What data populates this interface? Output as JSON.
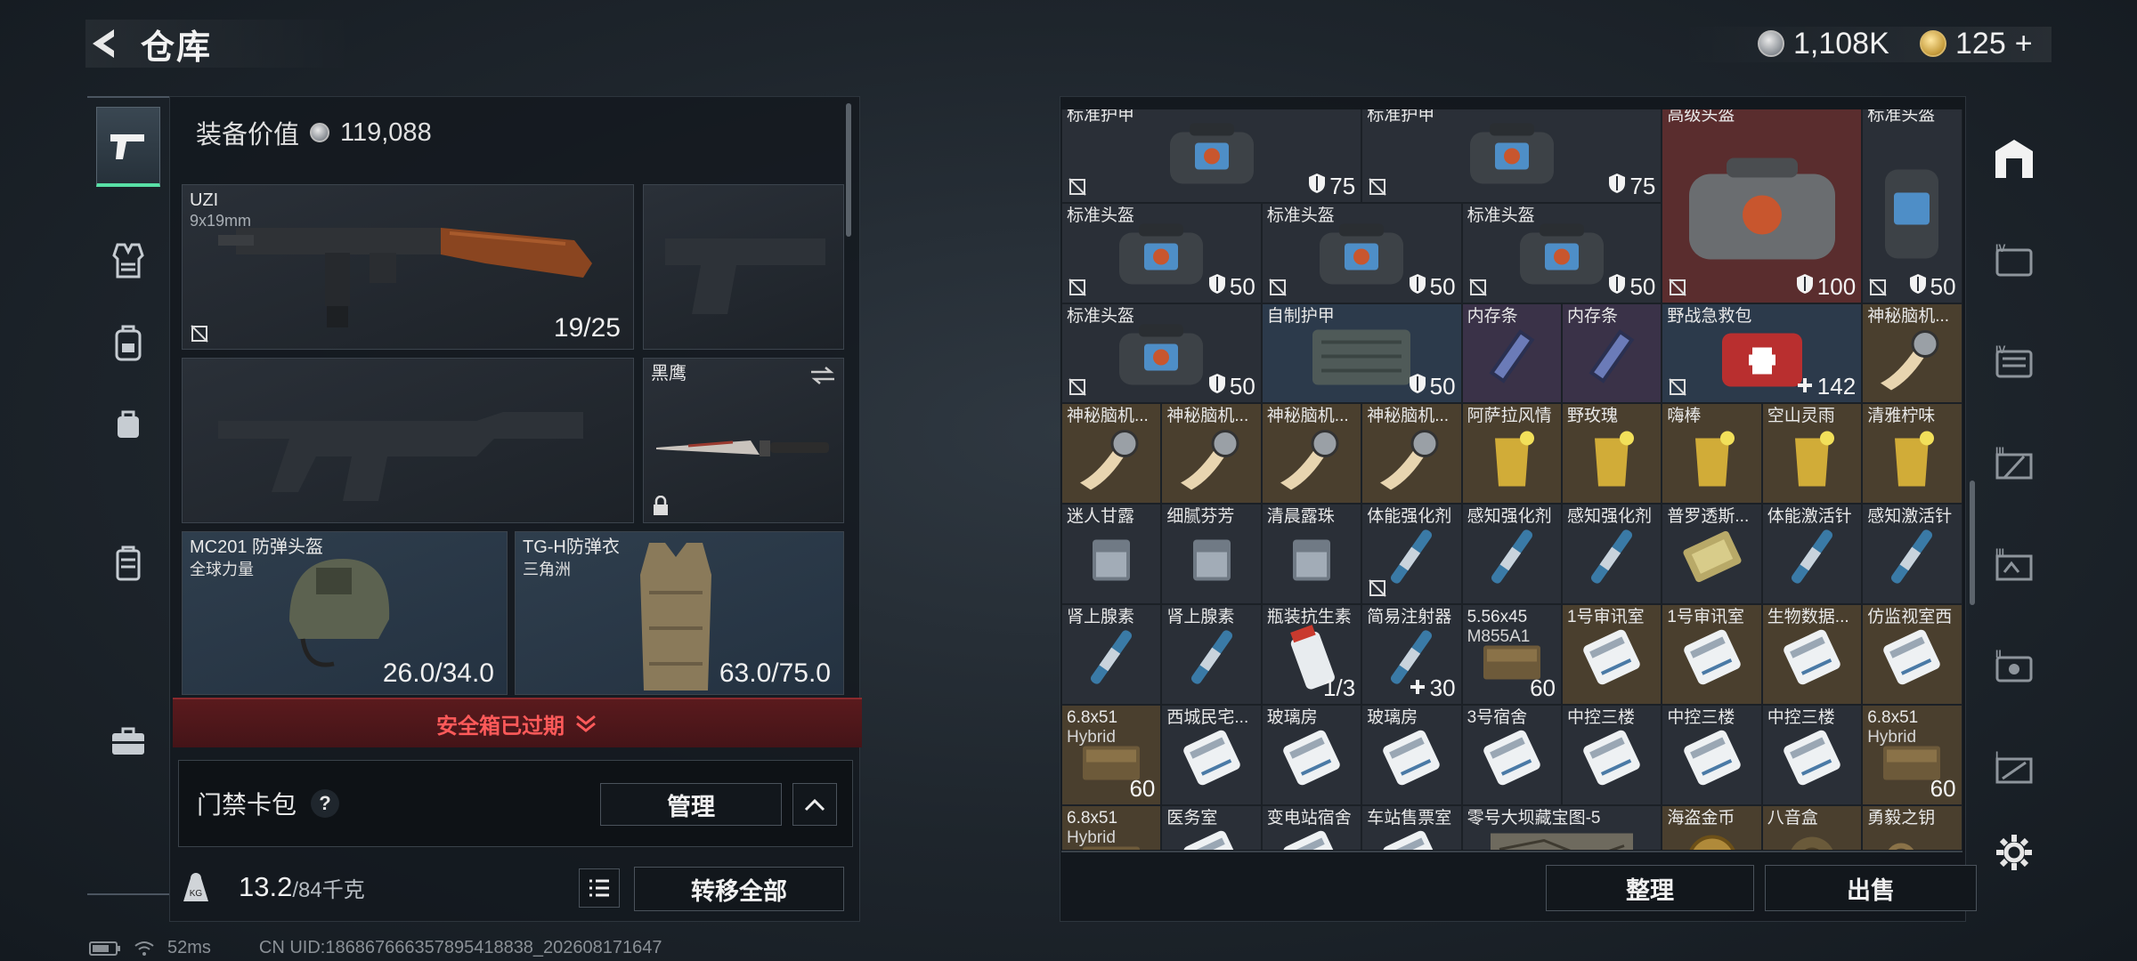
{
  "header": {
    "title": "仓库",
    "back_icon": "back-arrow-icon"
  },
  "currency": {
    "silver": "1,108K",
    "gold": "125",
    "gold_add": "+"
  },
  "left_nav": [
    {
      "name": "weapon",
      "icon": "pistol-icon",
      "active": true
    },
    {
      "name": "armor",
      "icon": "vest-icon"
    },
    {
      "name": "backpack",
      "icon": "backpack-icon"
    },
    {
      "name": "bag",
      "icon": "small-bag-icon"
    },
    {
      "name": "case",
      "icon": "case-icon"
    },
    {
      "name": "toolbox",
      "icon": "toolbox-icon"
    }
  ],
  "equipment": {
    "value_label": "装备价值",
    "value": "119,088",
    "primary": {
      "name": "UZI",
      "ammo": "9x19mm",
      "count": "19/25"
    },
    "melee": {
      "name": "黑鹰"
    },
    "helmet": {
      "name": "MC201 防弹头盔",
      "sub": "全球力量",
      "durability": "26.0/34.0"
    },
    "armor": {
      "name": "TG-H防弹衣",
      "sub": "三角洲",
      "durability": "63.0/75.0"
    }
  },
  "safebox": {
    "expired_text": "安全箱已过期"
  },
  "keycard": {
    "label": "门禁卡包",
    "help": "?",
    "manage": "管理"
  },
  "weight": {
    "current": "13.2",
    "max": "/84千克",
    "unit_icon": "KG"
  },
  "transfer_all": "转移全部",
  "stash": {
    "rows": [
      [
        {
          "n": "标准护甲",
          "v": "75",
          "t": "shield"
        },
        {
          "n": "标准护甲",
          "v": "75",
          "t": "shield"
        },
        {
          "n": "高级头盔",
          "v": "100",
          "t": "shield"
        },
        {
          "n": "标准头盔",
          "v": "50",
          "t": "shield"
        }
      ],
      [
        {
          "n": "标准头盔",
          "v": "50"
        },
        {
          "n": "标准头盔",
          "v": "50"
        },
        {
          "n": "标准头盔",
          "v": "50"
        }
      ],
      [
        {
          "n": "标准头盔",
          "v": "50"
        },
        {
          "n": "自制护甲",
          "v": "50"
        },
        {
          "n": "内存条"
        },
        {
          "n": "内存条"
        },
        {
          "n": "野战急救包",
          "v": "142"
        },
        {
          "n": "神秘脑机..."
        }
      ],
      [
        {
          "n": "神秘脑机..."
        },
        {
          "n": "神秘脑机..."
        },
        {
          "n": "神秘脑机..."
        },
        {
          "n": "神秘脑机..."
        },
        {
          "n": "阿萨拉风情"
        },
        {
          "n": "野玫瑰"
        },
        {
          "n": "嗨棒"
        },
        {
          "n": "空山灵雨"
        },
        {
          "n": "清雅柠味"
        }
      ],
      [
        {
          "n": "迷人甘露"
        },
        {
          "n": "细腻芬芳"
        },
        {
          "n": "清晨露珠"
        },
        {
          "n": "体能强化剂"
        },
        {
          "n": "感知强化剂"
        },
        {
          "n": "感知强化剂"
        },
        {
          "n": "普罗透斯..."
        },
        {
          "n": "体能激活针"
        },
        {
          "n": "感知激活针"
        }
      ],
      [
        {
          "n": "肾上腺素"
        },
        {
          "n": "肾上腺素"
        },
        {
          "n": "瓶装抗生素",
          "v": "1/3"
        },
        {
          "n": "简易注射器",
          "v": "30"
        },
        {
          "n": "5.56x45",
          "n2": "M855A1",
          "v": "60"
        },
        {
          "n": "1号审讯室"
        },
        {
          "n": "1号审讯室"
        },
        {
          "n": "生物数据..."
        },
        {
          "n": "仿监视室西"
        }
      ],
      [
        {
          "n": "6.8x51",
          "n2": "Hybrid",
          "v": "60"
        },
        {
          "n": "西城民宅..."
        },
        {
          "n": "玻璃房"
        },
        {
          "n": "玻璃房"
        },
        {
          "n": "3号宿舍"
        },
        {
          "n": "中控三楼"
        },
        {
          "n": "中控三楼"
        },
        {
          "n": "中控三楼"
        },
        {
          "n": "6.8x51",
          "n2": "Hybrid",
          "v": "60"
        }
      ],
      [
        {
          "n": "6.8x51",
          "n2": "Hybrid"
        },
        {
          "n": "医务室"
        },
        {
          "n": "变电站宿舍"
        },
        {
          "n": "车站售票室"
        },
        {
          "n": "零号大坝藏宝图-5"
        },
        {
          "n": "海盗金币"
        },
        {
          "n": "八音盒"
        },
        {
          "n": "勇毅之钥"
        }
      ]
    ]
  },
  "stash_buttons": {
    "sort": "整理",
    "sell": "出售"
  },
  "right_nav": [
    {
      "icon": "storage-icon",
      "active": true
    },
    {
      "icon": "tab-iv-1-icon",
      "label": "IV"
    },
    {
      "icon": "tab-iv-2-icon",
      "label": "IV"
    },
    {
      "icon": "tab-iii-1-icon",
      "label": "III"
    },
    {
      "icon": "tab-iii-2-icon",
      "label": "III"
    },
    {
      "icon": "tab-ii-icon",
      "label": "II"
    },
    {
      "icon": "tab-i-1-icon",
      "label": "I"
    },
    {
      "icon": "tab-i-2-icon",
      "label": "I"
    },
    {
      "icon": "settings-icon"
    }
  ],
  "status": {
    "ping": "52ms",
    "uid": "CN UID:18686766635789541883​8_202608171647"
  }
}
